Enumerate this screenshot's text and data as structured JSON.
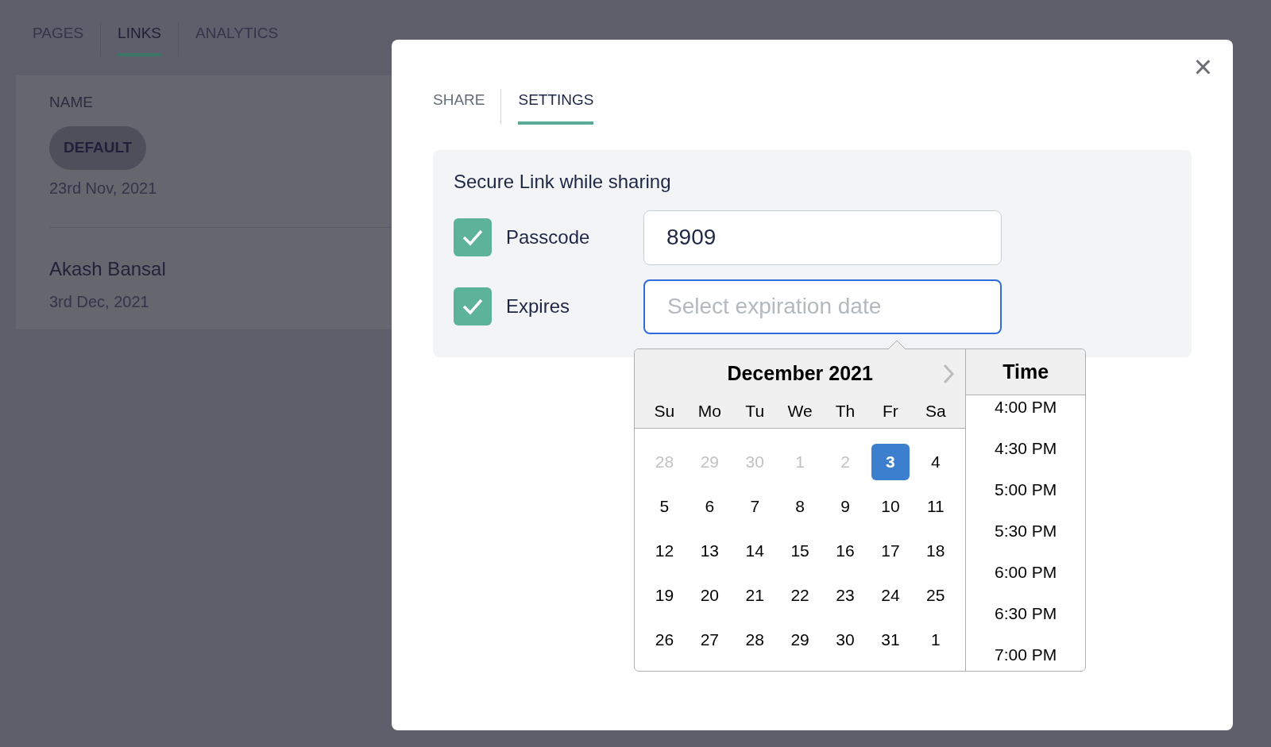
{
  "background": {
    "tabs": [
      {
        "label": "PAGES",
        "selected": false
      },
      {
        "label": "LINKS",
        "selected": true
      },
      {
        "label": "ANALYTICS",
        "selected": false
      }
    ],
    "column_header": "NAME",
    "rows": [
      {
        "kind": "badge",
        "title": "DEFAULT",
        "date": "23rd Nov, 2021"
      },
      {
        "kind": "name",
        "title": "Akash Bansal",
        "date": "3rd Dec, 2021"
      }
    ]
  },
  "modal": {
    "close": "×",
    "tabs": [
      {
        "label": "SHARE",
        "selected": false
      },
      {
        "label": "SETTINGS",
        "selected": true
      }
    ],
    "section_title": "Secure Link while sharing",
    "options": [
      {
        "label": "Passcode",
        "checked": true,
        "value": "8909",
        "focused": false
      },
      {
        "label": "Expires",
        "checked": true,
        "placeholder": "Select expiration date",
        "focused": true
      }
    ],
    "datepicker": {
      "month": "December 2021",
      "weekdays": [
        "Su",
        "Mo",
        "Tu",
        "We",
        "Th",
        "Fr",
        "Sa"
      ],
      "days": [
        {
          "label": "28",
          "outside": true,
          "selected": false
        },
        {
          "label": "29",
          "outside": true,
          "selected": false
        },
        {
          "label": "30",
          "outside": true,
          "selected": false
        },
        {
          "label": "1",
          "outside": true,
          "selected": false
        },
        {
          "label": "2",
          "outside": true,
          "selected": false
        },
        {
          "label": "3",
          "outside": false,
          "selected": true
        },
        {
          "label": "4",
          "outside": false,
          "selected": false
        },
        {
          "label": "5",
          "outside": false,
          "selected": false
        },
        {
          "label": "6",
          "outside": false,
          "selected": false
        },
        {
          "label": "7",
          "outside": false,
          "selected": false
        },
        {
          "label": "8",
          "outside": false,
          "selected": false
        },
        {
          "label": "9",
          "outside": false,
          "selected": false
        },
        {
          "label": "10",
          "outside": false,
          "selected": false
        },
        {
          "label": "11",
          "outside": false,
          "selected": false
        },
        {
          "label": "12",
          "outside": false,
          "selected": false
        },
        {
          "label": "13",
          "outside": false,
          "selected": false
        },
        {
          "label": "14",
          "outside": false,
          "selected": false
        },
        {
          "label": "15",
          "outside": false,
          "selected": false
        },
        {
          "label": "16",
          "outside": false,
          "selected": false
        },
        {
          "label": "17",
          "outside": false,
          "selected": false
        },
        {
          "label": "18",
          "outside": false,
          "selected": false
        },
        {
          "label": "19",
          "outside": false,
          "selected": false
        },
        {
          "label": "20",
          "outside": false,
          "selected": false
        },
        {
          "label": "21",
          "outside": false,
          "selected": false
        },
        {
          "label": "22",
          "outside": false,
          "selected": false
        },
        {
          "label": "23",
          "outside": false,
          "selected": false
        },
        {
          "label": "24",
          "outside": false,
          "selected": false
        },
        {
          "label": "25",
          "outside": false,
          "selected": false
        },
        {
          "label": "26",
          "outside": false,
          "selected": false
        },
        {
          "label": "27",
          "outside": false,
          "selected": false
        },
        {
          "label": "28",
          "outside": false,
          "selected": false
        },
        {
          "label": "29",
          "outside": false,
          "selected": false
        },
        {
          "label": "30",
          "outside": false,
          "selected": false
        },
        {
          "label": "31",
          "outside": false,
          "selected": false
        },
        {
          "label": "1",
          "outside": false,
          "selected": false
        }
      ],
      "time_title": "Time",
      "times": [
        "4:00 PM",
        "4:30 PM",
        "5:00 PM",
        "5:30 PM",
        "6:00 PM",
        "6:30 PM",
        "7:00 PM"
      ]
    }
  }
}
